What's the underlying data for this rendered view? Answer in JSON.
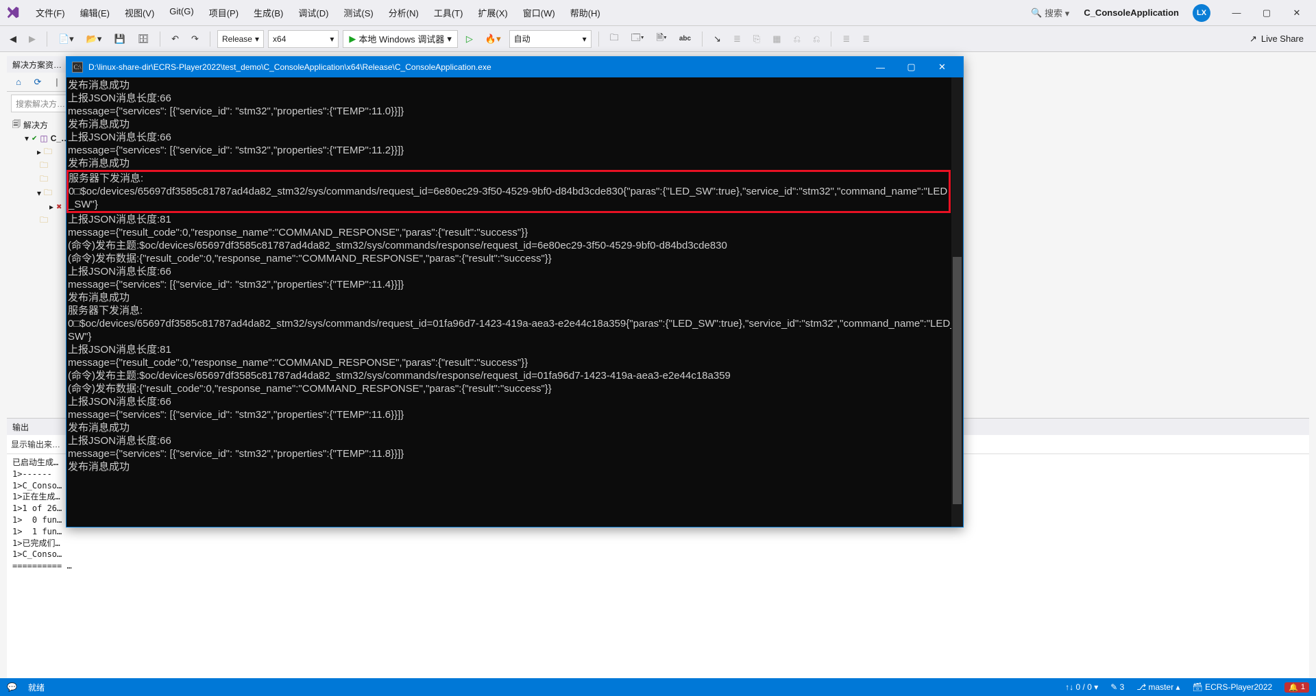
{
  "titlebar": {
    "menu": [
      "文件(F)",
      "编辑(E)",
      "视图(V)",
      "Git(G)",
      "项目(P)",
      "生成(B)",
      "调试(D)",
      "测试(S)",
      "分析(N)",
      "工具(T)",
      "扩展(X)",
      "窗口(W)",
      "帮助(H)"
    ],
    "search_placeholder": "搜索 ▾",
    "solution_name": "C_ConsoleApplication",
    "user_initials": "LX"
  },
  "toolbar": {
    "config": "Release",
    "platform": "x64",
    "run_label": "本地 Windows 调试器",
    "auto": "自动",
    "live_share": "Live Share"
  },
  "solution_explorer": {
    "title": "解决方案资…",
    "search_placeholder": "搜索解决方…",
    "nodes": {
      "root": "解决方",
      "proj": "C_…",
      "items": [
        "",
        "",
        "",
        "",
        "",
        ""
      ]
    }
  },
  "output": {
    "title": "输出",
    "from_label": "显示输出来…",
    "lines": [
      "已启动生成…",
      "1>------",
      "1>C_Conso…",
      "1>正在生成…",
      "1>1 of 26…",
      "1>  0 fun…",
      "1>  1 fun…",
      "1>已完成们…",
      "1>C_Conso…",
      "========== …"
    ]
  },
  "console": {
    "title": "D:\\linux-share-dir\\ECRS-Player2022\\test_demo\\C_ConsoleApplication\\x64\\Release\\C_ConsoleApplication.exe",
    "pre_lines": "发布消息成功\n上报JSON消息长度:66\nmessage={\"services\": [{\"service_id\": \"stm32\",\"properties\":{\"TEMP\":11.0}}]}\n发布消息成功\n上报JSON消息长度:66\nmessage={\"services\": [{\"service_id\": \"stm32\",\"properties\":{\"TEMP\":11.2}}]}\n发布消息成功",
    "boxed_lines": "服务器下发消息:\n0□$oc/devices/65697df3585c81787ad4da82_stm32/sys/commands/request_id=6e80ec29-3f50-4529-9bf0-d84bd3cde830{\"paras\":{\"LED_SW\":true},\"service_id\":\"stm32\",\"command_name\":\"LED_SW\"}",
    "post_lines": "上报JSON消息长度:81\nmessage={\"result_code\":0,\"response_name\":\"COMMAND_RESPONSE\",\"paras\":{\"result\":\"success\"}}\n(命令)发布主题:$oc/devices/65697df3585c81787ad4da82_stm32/sys/commands/response/request_id=6e80ec29-3f50-4529-9bf0-d84bd3cde830\n(命令)发布数据:{\"result_code\":0,\"response_name\":\"COMMAND_RESPONSE\",\"paras\":{\"result\":\"success\"}}\n上报JSON消息长度:66\nmessage={\"services\": [{\"service_id\": \"stm32\",\"properties\":{\"TEMP\":11.4}}]}\n发布消息成功\n服务器下发消息:\n0□$oc/devices/65697df3585c81787ad4da82_stm32/sys/commands/request_id=01fa96d7-1423-419a-aea3-e2e44c18a359{\"paras\":{\"LED_SW\":true},\"service_id\":\"stm32\",\"command_name\":\"LED_SW\"}\n上报JSON消息长度:81\nmessage={\"result_code\":0,\"response_name\":\"COMMAND_RESPONSE\",\"paras\":{\"result\":\"success\"}}\n(命令)发布主题:$oc/devices/65697df3585c81787ad4da82_stm32/sys/commands/response/request_id=01fa96d7-1423-419a-aea3-e2e44c18a359\n(命令)发布数据:{\"result_code\":0,\"response_name\":\"COMMAND_RESPONSE\",\"paras\":{\"result\":\"success\"}}\n上报JSON消息长度:66\nmessage={\"services\": [{\"service_id\": \"stm32\",\"properties\":{\"TEMP\":11.6}}]}\n发布消息成功\n上报JSON消息长度:66\nmessage={\"services\": [{\"service_id\": \"stm32\",\"properties\":{\"TEMP\":11.8}}]}\n发布消息成功"
  },
  "statusbar": {
    "ready": "就绪",
    "issues": "0 / 0",
    "changes": "3",
    "branch": "master ▴",
    "repo": "ECRS-Player2022",
    "notif": "1"
  }
}
